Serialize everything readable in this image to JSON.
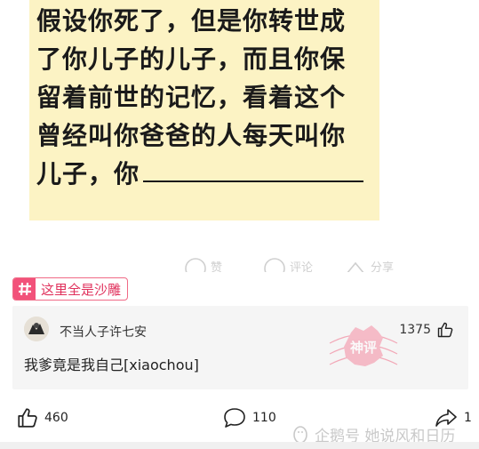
{
  "meme": {
    "lines": [
      "假设你死了，但是你转世成",
      "了你儿子的儿子，而且你保",
      "留着前世的记忆，看着这个",
      "曾经叫你爸爸的人每天叫你",
      "儿子，你"
    ]
  },
  "post_actions": {
    "like_label": "赞",
    "comment_label": "评论",
    "share_label": "分享"
  },
  "topic_tag": {
    "icon": "hash-icon",
    "label": "这里全是沙雕"
  },
  "god_comment": {
    "username": "不当人子许七安",
    "likes": "1375",
    "text": "我爹竟是我自己[xiaochou]",
    "stamp_text": "神评"
  },
  "bottom_bar": {
    "likes": "460",
    "comments": "110",
    "shares": "1"
  },
  "watermark": {
    "text": "企鹅号 她说风和日历"
  },
  "colors": {
    "meme_bg": "#fcf3c4",
    "tag_accent": "#f2527a",
    "stamp": "#f06a86"
  }
}
